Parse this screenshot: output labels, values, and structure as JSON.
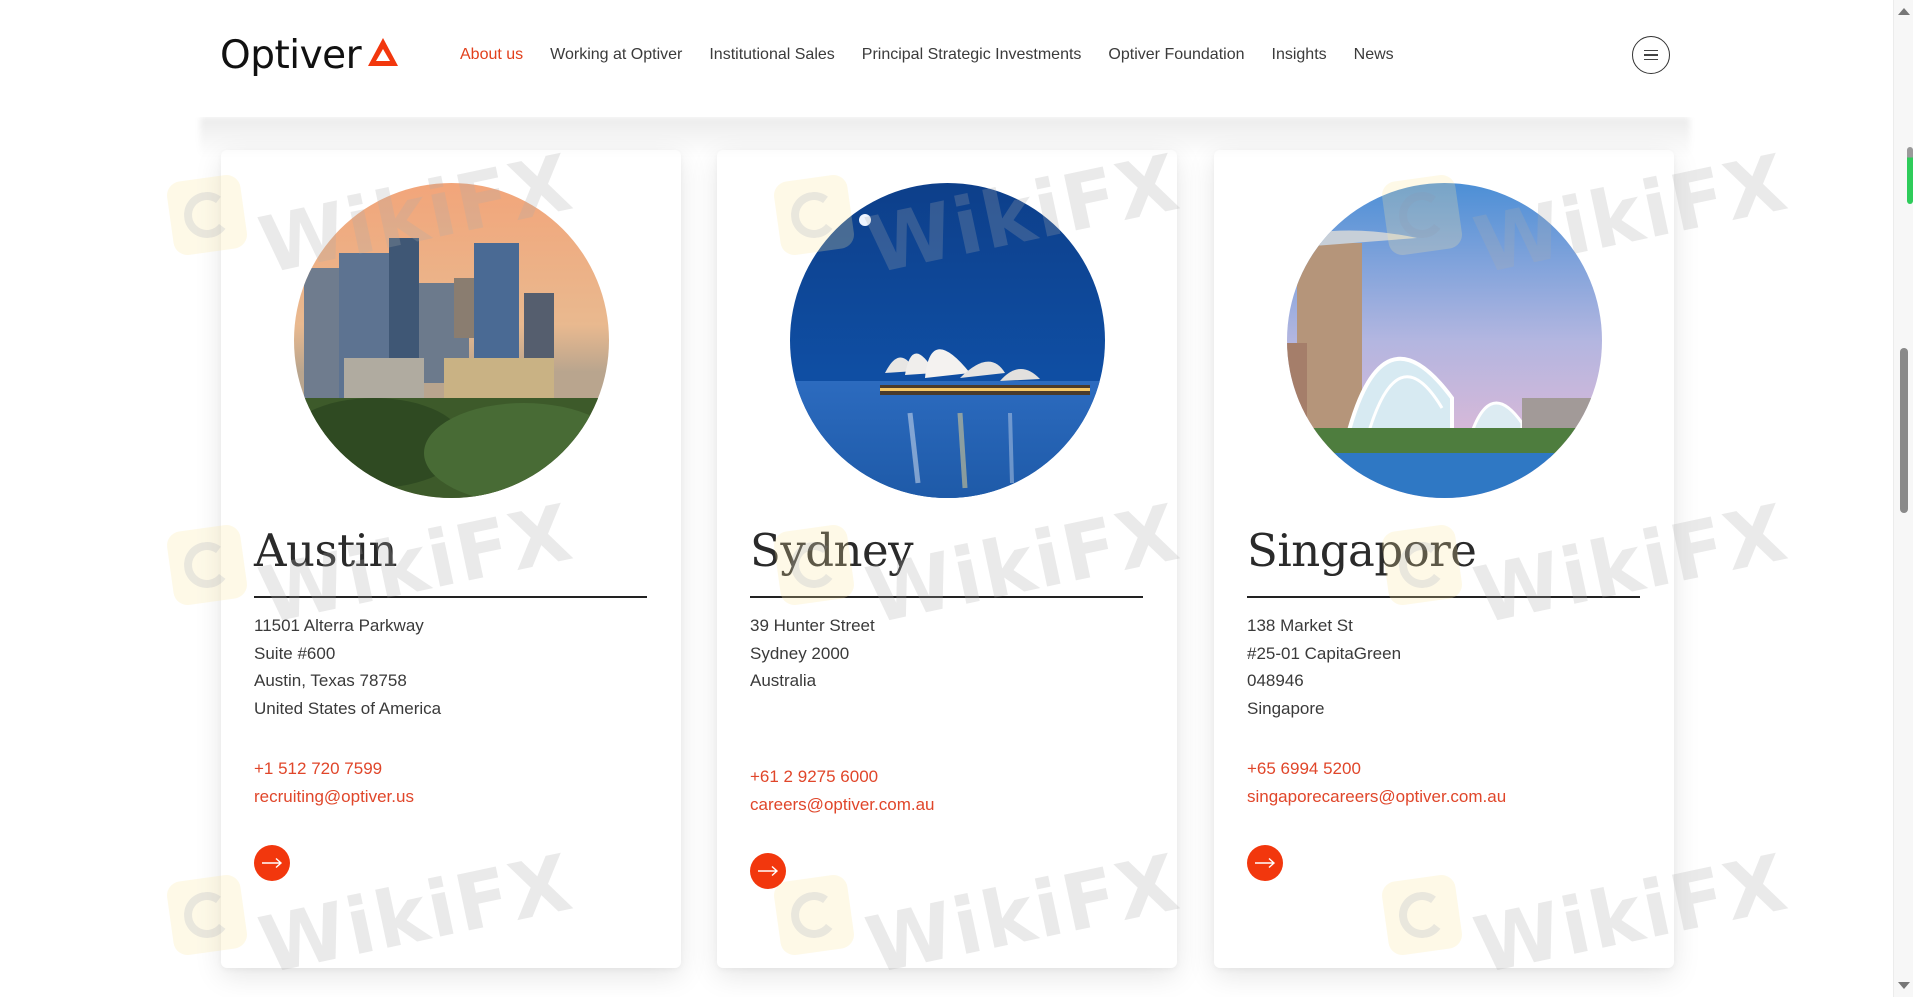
{
  "brand": {
    "name": "Optiver",
    "accent_color": "#e2401c",
    "button_color": "#f2370d"
  },
  "nav": {
    "items": [
      {
        "label": "About us",
        "active": true
      },
      {
        "label": "Working at Optiver",
        "active": false
      },
      {
        "label": "Institutional Sales",
        "active": false
      },
      {
        "label": "Principal Strategic Investments",
        "active": false
      },
      {
        "label": "Optiver Foundation",
        "active": false
      },
      {
        "label": "Insights",
        "active": false
      },
      {
        "label": "News",
        "active": false
      }
    ],
    "menu_icon": "hamburger-menu-icon"
  },
  "offices": [
    {
      "city": "Austin",
      "photo": "austin-skyline-photo",
      "address": [
        "11501 Alterra Parkway",
        "Suite #600",
        "Austin, Texas 78758",
        "United States of America"
      ],
      "phone": "+1 512 720 7599",
      "email": "recruiting@optiver.us",
      "button_icon": "arrow-right-icon"
    },
    {
      "city": "Sydney",
      "photo": "sydney-opera-house-photo",
      "address": [
        "39 Hunter Street",
        "Sydney 2000",
        "Australia"
      ],
      "phone": "+61 2 9275 6000",
      "email": "careers@optiver.com.au",
      "button_icon": "arrow-right-icon"
    },
    {
      "city": "Singapore",
      "photo": "singapore-gardens-photo",
      "address": [
        "138 Market St",
        "#25-01 CapitaGreen",
        "048946",
        "Singapore"
      ],
      "phone": "+65 6994 5200",
      "email": "singaporecareers@optiver.com.au",
      "button_icon": "arrow-right-icon"
    }
  ],
  "watermark": {
    "text": "WikiFX"
  }
}
